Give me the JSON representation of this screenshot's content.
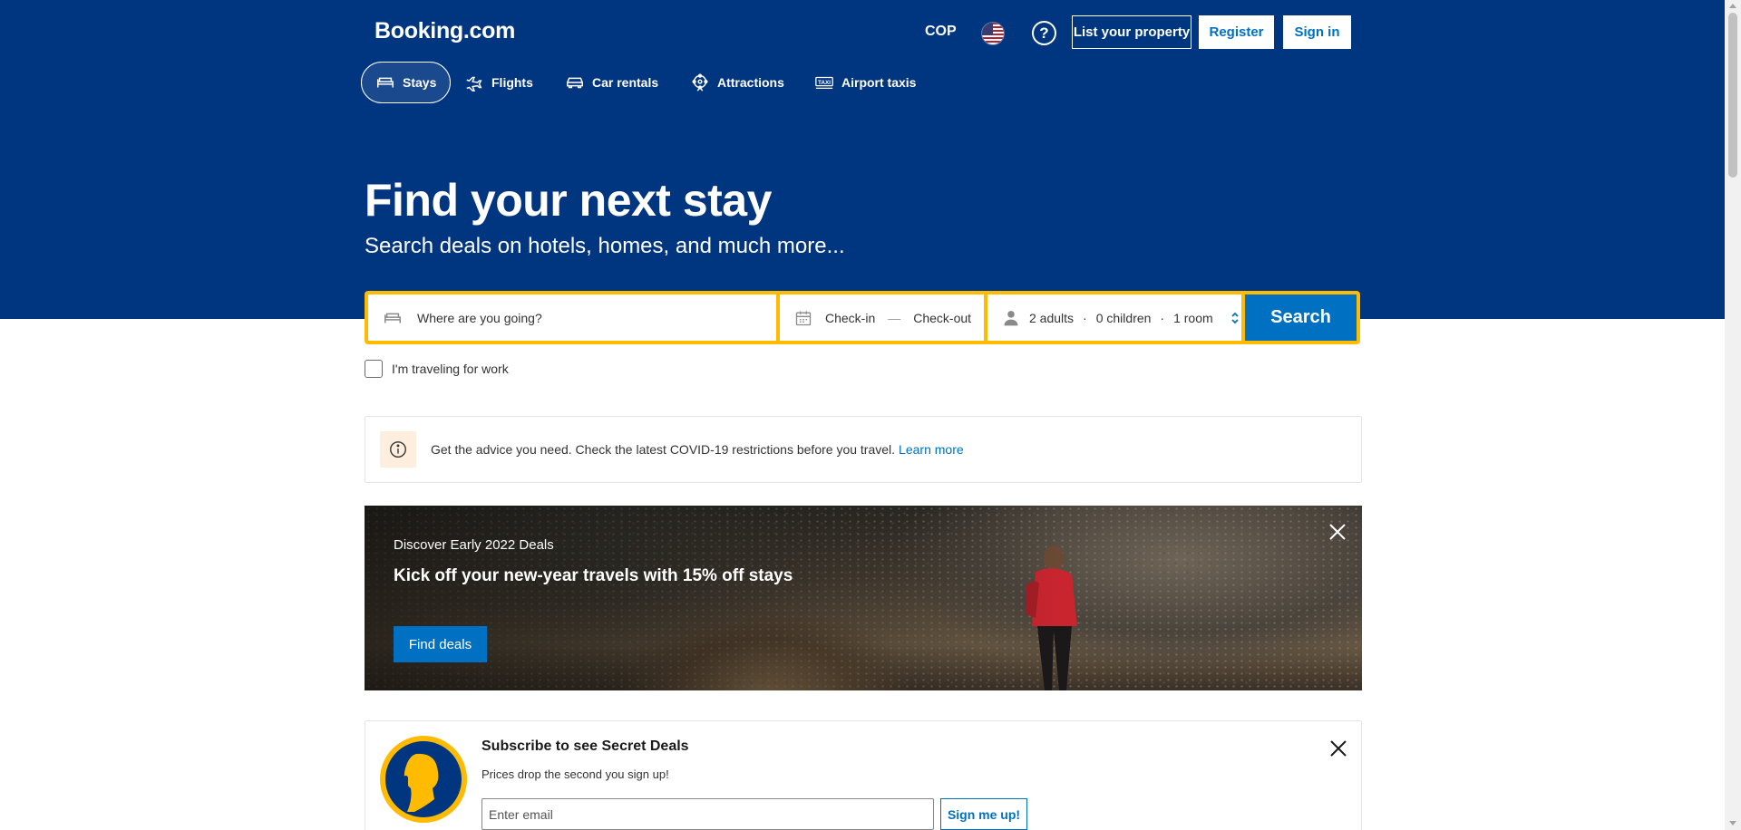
{
  "header": {
    "logo": "Booking.com",
    "currency": "COP",
    "help_symbol": "?",
    "list_property_label": "List your property",
    "register_label": "Register",
    "signin_label": "Sign in"
  },
  "nav": {
    "items": [
      {
        "label": "Stays",
        "icon": "bed-icon",
        "active": true
      },
      {
        "label": "Flights",
        "icon": "plane-icon"
      },
      {
        "label": "Car rentals",
        "icon": "car-icon"
      },
      {
        "label": "Attractions",
        "icon": "attractions-icon"
      },
      {
        "label": "Airport taxis",
        "icon": "taxi-icon"
      }
    ]
  },
  "hero": {
    "title": "Find your next stay",
    "subtitle": "Search deals on hotels, homes, and much more..."
  },
  "search": {
    "destination_placeholder": "Where are you going?",
    "checkin_label": "Check-in",
    "date_separator": "—",
    "checkout_label": "Check-out",
    "adults": "2 adults",
    "children": "0 children",
    "rooms": "1 room",
    "dot": "·",
    "search_label": "Search",
    "work_travel_label": "I'm traveling for work"
  },
  "notice": {
    "text": "Get the advice you need. Check the latest COVID-19 restrictions before you travel.",
    "link_label": "Learn more"
  },
  "promo": {
    "eyebrow": "Discover Early 2022 Deals",
    "title": "Kick off your new-year travels with 15% off stays",
    "button_label": "Find deals"
  },
  "subscribe": {
    "title": "Subscribe to see Secret Deals",
    "text": "Prices drop the second you sign up!",
    "email_placeholder": "Enter email",
    "button_label": "Sign me up!"
  },
  "colors": {
    "brand_blue": "#003580",
    "action_blue": "#0071c2",
    "search_yellow": "#febb02"
  }
}
